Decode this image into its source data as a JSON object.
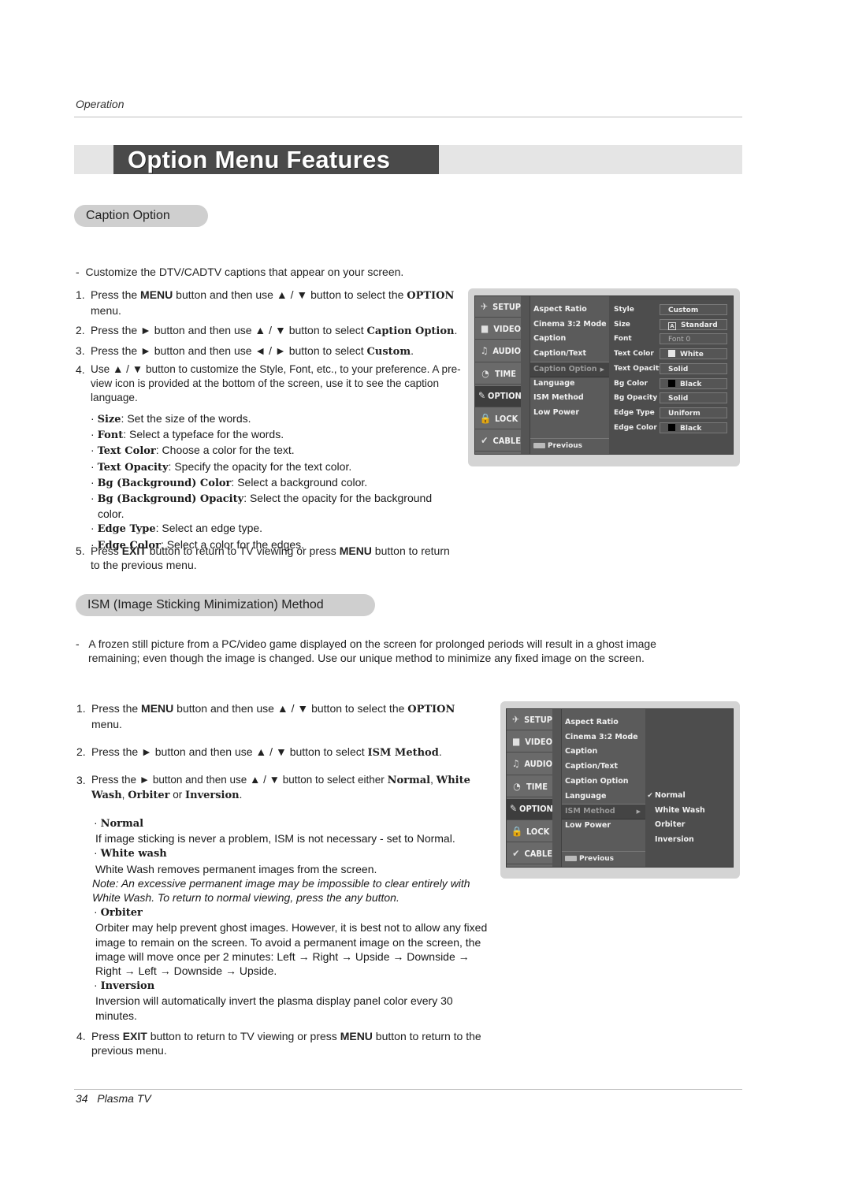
{
  "header": {
    "section": "Operation"
  },
  "title": "Option Menu Features",
  "caption_section": {
    "heading": "Caption Option",
    "intro": "Customize the DTV/CADTV captions that appear on your screen.",
    "steps": [
      {
        "num": "1.",
        "parts": [
          "Press the ",
          "MENU",
          " button and then use ▲ / ▼ button to select the ",
          "OPTION",
          " menu."
        ]
      },
      {
        "num": "2.",
        "parts": [
          "Press the ► button and then use ▲ / ▼ button to select ",
          "Caption Option",
          "."
        ]
      },
      {
        "num": "3.",
        "parts": [
          "Press the ► button and then use ◄ / ► button to select ",
          "Custom",
          "."
        ]
      },
      {
        "num": "4.",
        "text": "Use ▲ / ▼ button to customize the Style, Font, etc., to your preference. A pre-view icon is provided at the bottom of the screen, use it to see the caption language."
      },
      {
        "num": "5.",
        "parts": [
          "Press ",
          "EXIT",
          " button to return to TV viewing or press ",
          "MENU",
          " button to return to the previous menu."
        ]
      }
    ],
    "bullets": [
      {
        "term": "Size",
        "desc": ": Set the size of the words."
      },
      {
        "term": "Font",
        "desc": ": Select a typeface for the words."
      },
      {
        "term": "Text Color",
        "desc": ": Choose a color for the text."
      },
      {
        "term": "Text Opacity",
        "desc": ": Specify the opacity for the text color."
      },
      {
        "term": "Bg (Background) Color",
        "desc": ": Select a background color."
      },
      {
        "term": "Bg (Background) Opacity",
        "desc": ": Select the opacity for the background color."
      },
      {
        "term": "Edge Type",
        "desc": ": Select an edge type."
      },
      {
        "term": "Edge Color",
        "desc": ": Select a color for the edges."
      }
    ]
  },
  "tv_menu": {
    "tabs": [
      {
        "label": "SETUP",
        "icon": "satellite-icon"
      },
      {
        "label": "VIDEO",
        "icon": "video-icon"
      },
      {
        "label": "AUDIO",
        "icon": "speaker-icon"
      },
      {
        "label": "TIME",
        "icon": "clock-icon"
      },
      {
        "label": "OPTION",
        "icon": "option-tag-icon",
        "active": true
      },
      {
        "label": "LOCK",
        "icon": "lock-icon"
      },
      {
        "label": "CABLE",
        "icon": "cable-check-icon"
      }
    ],
    "items": [
      "Aspect Ratio",
      "Cinema 3:2 Mode",
      "Caption",
      "Caption/Text",
      "Caption Option",
      "Language",
      "ISM Method",
      "Low Power"
    ],
    "previous": "Previous",
    "menu_key": "MENU",
    "caption_options": [
      {
        "label": "Style",
        "value": "Custom"
      },
      {
        "label": "Size",
        "value": "Standard",
        "swatch": "A"
      },
      {
        "label": "Font",
        "value": "Font 0",
        "dim": true
      },
      {
        "label": "Text Color",
        "value": "White",
        "swatch_color": "#e6e6e6"
      },
      {
        "label": "Text Opacity",
        "value": "Solid"
      },
      {
        "label": "Bg Color",
        "value": "Black",
        "swatch_color": "#000000"
      },
      {
        "label": "Bg Opacity",
        "value": "Solid"
      },
      {
        "label": "Edge Type",
        "value": "Uniform"
      },
      {
        "label": "Edge Color",
        "value": "Black",
        "swatch_color": "#000000"
      }
    ],
    "ism_options": [
      {
        "label": "Normal",
        "checked": true
      },
      {
        "label": "White Wash"
      },
      {
        "label": "Orbiter"
      },
      {
        "label": "Inversion"
      }
    ]
  },
  "ism_section": {
    "heading": "ISM (Image Sticking Minimization) Method",
    "intro": "A frozen still picture from a PC/video game displayed on the screen for prolonged periods will result in a ghost image remaining; even though the image is changed. Use our unique method to minimize any fixed image on the screen.",
    "steps": [
      {
        "num": "1.",
        "parts": [
          "Press the ",
          "MENU",
          " button and then use ▲ / ▼  button to select the ",
          "OPTION",
          " menu."
        ]
      },
      {
        "num": "2.",
        "parts": [
          "Press the ► button and then use ▲ / ▼ button to select ",
          "ISM Method",
          "."
        ]
      },
      {
        "num": "3.",
        "parts": [
          "Press the ► button and then use ▲ / ▼ button to select either ",
          "Normal",
          ", ",
          "White Wash",
          ", ",
          "Orbiter",
          " or ",
          "Inversion",
          "."
        ]
      },
      {
        "num": "4.",
        "parts": [
          "Press ",
          "EXIT",
          " button to return to TV viewing or press ",
          "MENU",
          " button to return to the previous menu."
        ]
      }
    ],
    "modes": [
      {
        "term": "Normal",
        "desc": "If image sticking is never a problem, ISM is not necessary - set to Normal."
      },
      {
        "term": "White wash",
        "desc": "White Wash removes permanent images from the screen.",
        "note": "Note: An excessive permanent image may be impossible to clear entirely with White Wash. To return to normal viewing, press the any button."
      },
      {
        "term": "Orbiter",
        "desc": "Orbiter may help prevent ghost images. However, it is best not to allow any fixed image to remain on the screen. To avoid a permanent image on the screen, the image will move once per 2 minutes: Left → Right → Upside → Downside → Right → Left → Downside → Upside."
      },
      {
        "term": "Inversion",
        "desc": "Inversion will automatically invert the plasma display panel color every 30 minutes."
      }
    ]
  },
  "footer": {
    "page": "34",
    "product": "Plasma TV"
  }
}
